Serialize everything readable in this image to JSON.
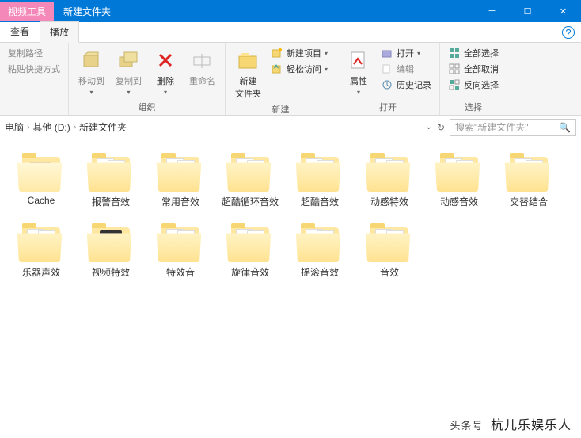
{
  "titlebar": {
    "tool_tab": "视频工具",
    "title": "新建文件夹"
  },
  "tabs": {
    "view": "查看",
    "play": "播放"
  },
  "ribbon": {
    "clipboard": {
      "copy_path": "复制路径",
      "paste_shortcut": "粘贴快捷方式",
      "label": ""
    },
    "organize": {
      "move_to": "移动到",
      "copy_to": "复制到",
      "delete": "删除",
      "rename": "重命名",
      "label": "组织"
    },
    "new": {
      "new_folder": "新建\n文件夹",
      "new_item": "新建项目",
      "easy_access": "轻松访问",
      "label": "新建"
    },
    "open": {
      "properties": "属性",
      "open": "打开",
      "edit": "编辑",
      "history": "历史记录",
      "label": "打开"
    },
    "select": {
      "select_all": "全部选择",
      "select_none": "全部取消",
      "invert": "反向选择",
      "label": "选择"
    }
  },
  "breadcrumb": {
    "pc": "电脑",
    "drive": "其他 (D:)",
    "folder": "新建文件夹"
  },
  "search": {
    "placeholder": "搜索\"新建文件夹\""
  },
  "folders": [
    {
      "name": "Cache",
      "type": "plain"
    },
    {
      "name": "报警音效",
      "type": "media"
    },
    {
      "name": "常用音效",
      "type": "media"
    },
    {
      "name": "超酷循环音效",
      "type": "media"
    },
    {
      "name": "超酷音效",
      "type": "media"
    },
    {
      "name": "动感特效",
      "type": "media"
    },
    {
      "name": "动感音效",
      "type": "media"
    },
    {
      "name": "交替结合",
      "type": "media"
    },
    {
      "name": "乐器声效",
      "type": "media"
    },
    {
      "name": "视频特效",
      "type": "video"
    },
    {
      "name": "特效音",
      "type": "media"
    },
    {
      "name": "旋律音效",
      "type": "media"
    },
    {
      "name": "摇滚音效",
      "type": "media"
    },
    {
      "name": "音效",
      "type": "media"
    }
  ],
  "watermark": {
    "prefix": "头条号",
    "text": "杭儿乐娱乐人"
  }
}
